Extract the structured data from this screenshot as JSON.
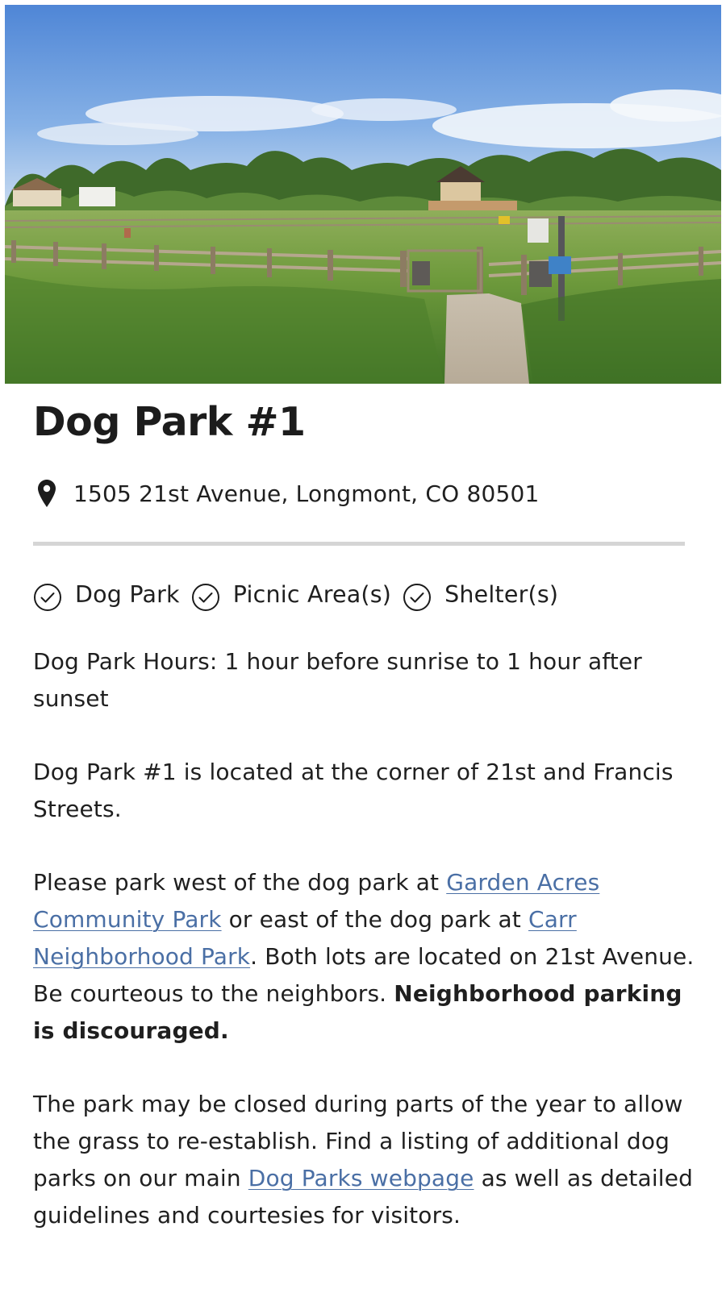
{
  "hero": {
    "image_name": "dog-park-photo"
  },
  "page": {
    "title": "Dog Park #1",
    "address": "1505 21st Avenue, Longmont, CO 80501"
  },
  "amenities": [
    {
      "label": "Dog Park",
      "icon": "check-circle-icon"
    },
    {
      "label": "Picnic Area(s)",
      "icon": "check-circle-icon"
    },
    {
      "label": "Shelter(s)",
      "icon": "check-circle-icon"
    }
  ],
  "body": {
    "hours": "Dog Park Hours: 1 hour before sunrise to 1 hour after sunset",
    "location": "Dog Park #1 is located at the corner of 21st and Francis Streets.",
    "parking": {
      "text_1": "Please park west of the dog park at ",
      "link_1": "Garden Acres Community Park",
      "text_2": " or east of the dog park at ",
      "link_2": "Carr Neighborhood Park",
      "text_3": ". Both lots are located on 21st Avenue. Be courteous to the neighbors. ",
      "bold": "Neighborhood parking is discouraged."
    },
    "closure": {
      "text_1": "The park may be closed during parts of the year to allow the grass to re-establish. Find a listing of additional dog parks on our main ",
      "link": "Dog Parks webpage",
      "text_2": " as well as detailed guidelines and courtesies for visitors."
    }
  },
  "colors": {
    "link": "#4a6fa5",
    "divider": "#d5d5d5",
    "text": "#1f1f1f"
  }
}
